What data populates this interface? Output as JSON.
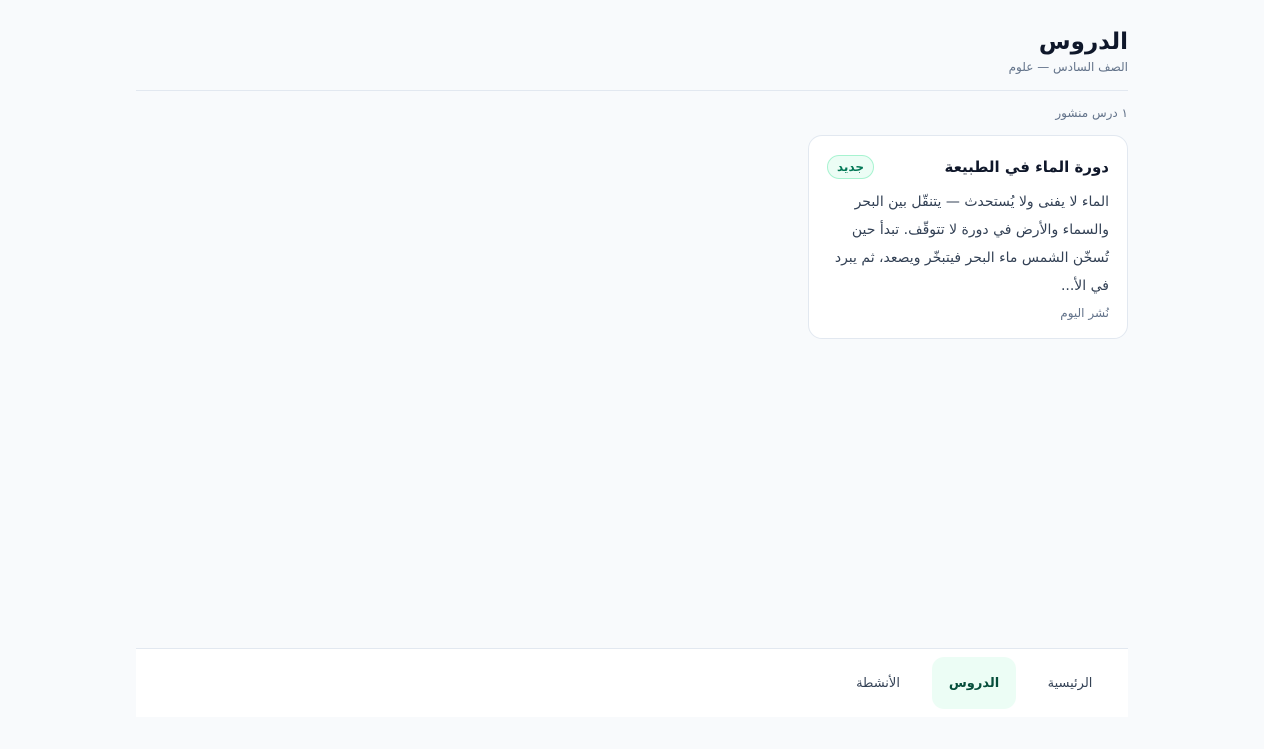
{
  "header": {
    "title": "الدروس",
    "subtitle": "الصف السادس — علوم"
  },
  "lessons_count": "١ درس منشور",
  "lessons": [
    {
      "title": "دورة الماء في الطبيعة",
      "badge": "جديد",
      "excerpt": "الماء لا يفنى ولا يُستحدث — يتنقّل بين البحر والسماء والأرض في دورة لا تتوقّف. تبدأ حين تُسخّن الشمس ماء البحر فيتبخّر ويصعد، ثم يبرد في الأ...",
      "published": "نُشر اليوم"
    }
  ],
  "nav": {
    "items": [
      {
        "label": "الرئيسية",
        "active": false
      },
      {
        "label": "الدروس",
        "active": true
      },
      {
        "label": "الأنشطة",
        "active": false
      }
    ]
  },
  "colors": {
    "accent": "#047857",
    "accent_bg": "#ecfdf5",
    "background": "#f8fafc"
  }
}
